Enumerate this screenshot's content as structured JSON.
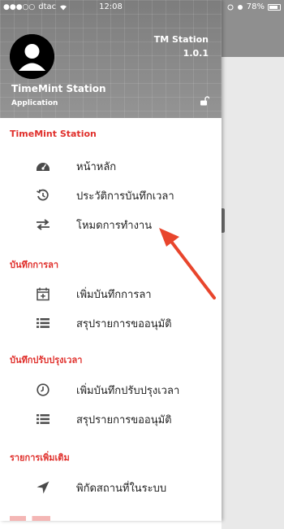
{
  "status_bar": {
    "carrier": "dtac",
    "time": "12:08",
    "battery": "78%"
  },
  "header": {
    "app_name": "TM Station",
    "version": "1.0.1",
    "title": "TimeMint Station",
    "subtitle": "Application"
  },
  "menu": {
    "section1": "TimeMint Station",
    "home": "หน้าหลัก",
    "history": "ประวัติการบันทึกเวลา",
    "mode": "โหมดการทำงาน",
    "section2": "บันทึกการลา",
    "add_leave": "เพิ่มบันทึกการลา",
    "leave_summary": "สรุปรายการขออนุมัติ",
    "section3": "บันทึกปรับปรุงเวลา",
    "add_adjust": "เพิ่มบันทึกปรับปรุงเวลา",
    "adjust_summary": "สรุปรายการขออนุมัติ",
    "section4": "รายการเพิ่มเติม",
    "location": "พิกัดสถานที่ในระบบ"
  },
  "colors": {
    "accent": "#e0302c",
    "icon": "#4a4a4a",
    "arrow": "#e8452c"
  }
}
